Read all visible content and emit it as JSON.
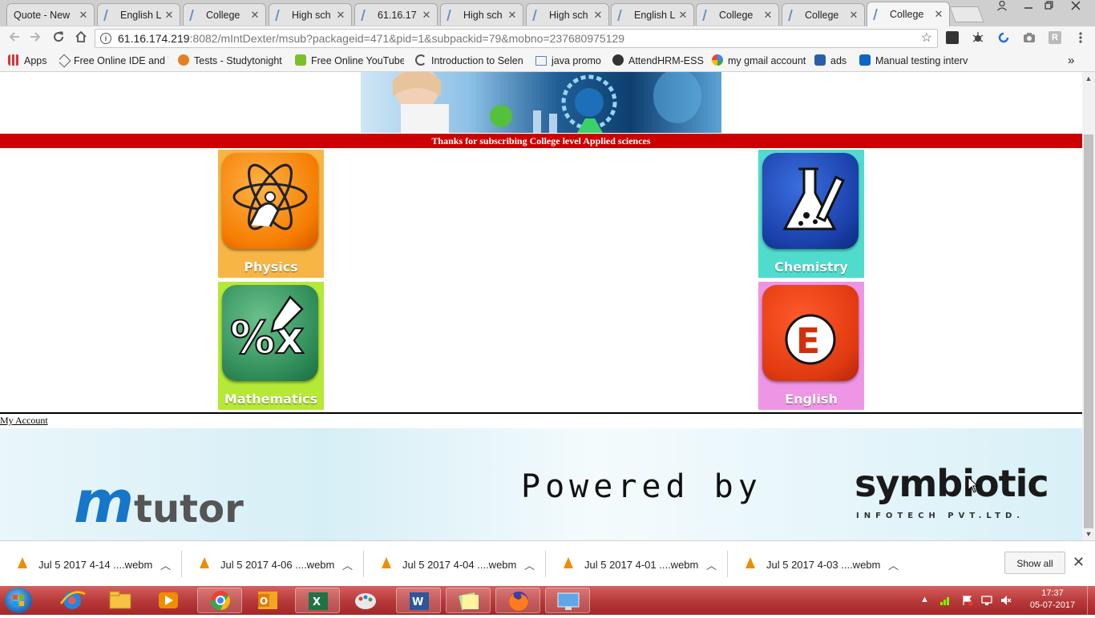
{
  "browser": {
    "tabs": [
      {
        "title": "Quote - New"
      },
      {
        "title": "English L"
      },
      {
        "title": "College"
      },
      {
        "title": "High sch"
      },
      {
        "title": "61.16.17"
      },
      {
        "title": "High sch"
      },
      {
        "title": "High sch"
      },
      {
        "title": "English L"
      },
      {
        "title": "College"
      },
      {
        "title": "College"
      },
      {
        "title": "College"
      }
    ],
    "close_glyph": "✕",
    "window_user_initial": "R",
    "url_host": "61.16.174.219",
    "url_rest": ":8082/mIntDexter/msub?packageid=471&pid=1&subpackid=79&mobno=237680975129",
    "bookmarks": [
      {
        "label": "Apps"
      },
      {
        "label": "Free Online IDE and T"
      },
      {
        "label": "Tests - Studytonight"
      },
      {
        "label": "Free Online YouTube"
      },
      {
        "label": "Introduction to Selen"
      },
      {
        "label": "java promo"
      },
      {
        "label": "AttendHRM-ESS"
      },
      {
        "label": "my gmail account"
      },
      {
        "label": "ads"
      },
      {
        "label": "Manual testing interv"
      }
    ],
    "bookmarks_overflow": "»"
  },
  "page": {
    "subscription_message": "Thanks for subscribing College level Applied sciences",
    "subjects": [
      {
        "label": "Physics",
        "color": "#f7941d"
      },
      {
        "label": "Chemistry",
        "color": "#49d6c8"
      },
      {
        "label": "Mathematics",
        "color": "#a6e02a"
      },
      {
        "label": "English",
        "color": "#ee8ee6"
      }
    ],
    "my_account": "My Account",
    "footer": {
      "brand_m": "m",
      "brand_rest": "tutor",
      "powered_by": "Powered by",
      "partner": "symbiotic",
      "partner_sub": "INFOTECH PVT.LTD."
    }
  },
  "downloads": {
    "items": [
      {
        "name": "Jul 5 2017 4-14 ....webm"
      },
      {
        "name": "Jul 5 2017 4-06 ....webm"
      },
      {
        "name": "Jul 5 2017 4-04 ....webm"
      },
      {
        "name": "Jul 5 2017 4-01 ....webm"
      },
      {
        "name": "Jul 5 2017 4-03 ....webm"
      }
    ],
    "show_all": "Show all"
  },
  "taskbar": {
    "time": "17:37",
    "date": "05-07-2017"
  },
  "colors": {
    "banner_red": "#cc0000",
    "taskbar_red": "#b93a3a"
  }
}
